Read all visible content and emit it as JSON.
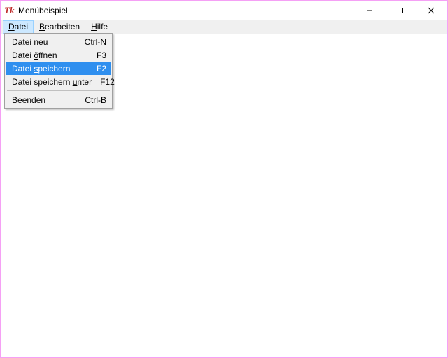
{
  "window": {
    "title": "Menübeispiel"
  },
  "menubar": {
    "items": [
      {
        "label": "Datei",
        "active": true
      },
      {
        "label": "Bearbeiten",
        "active": false
      },
      {
        "label": "Hilfe",
        "active": false
      }
    ]
  },
  "dropdown": {
    "items": [
      {
        "pre": "Datei ",
        "uchar": "n",
        "post": "eu",
        "shortcut": "Ctrl-N",
        "highlight": false
      },
      {
        "pre": "Datei ",
        "uchar": "ö",
        "post": "ffnen",
        "shortcut": "F3",
        "highlight": false
      },
      {
        "pre": "Datei ",
        "uchar": "s",
        "post": "peichern",
        "shortcut": "F2",
        "highlight": true
      },
      {
        "pre": "Datei speichern ",
        "uchar": "u",
        "post": "nter",
        "shortcut": "F12",
        "highlight": false
      },
      {
        "separator": true
      },
      {
        "pre": "",
        "uchar": "B",
        "post": "eenden",
        "shortcut": "Ctrl-B",
        "highlight": false
      }
    ]
  }
}
